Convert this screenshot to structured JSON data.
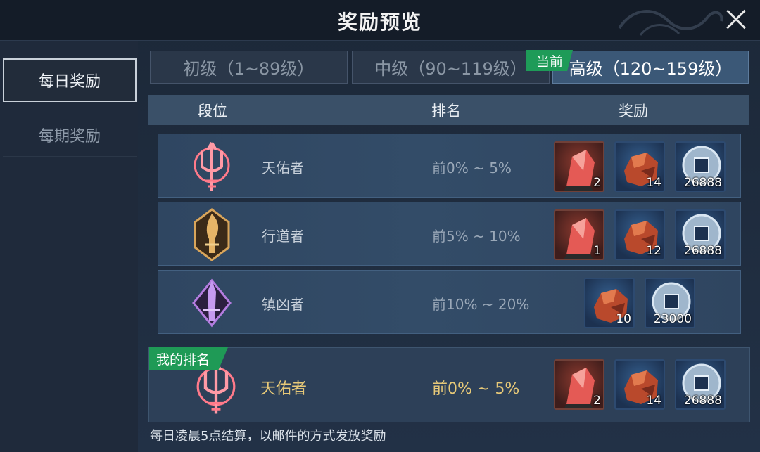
{
  "header": {
    "title": "奖励预览"
  },
  "sidebar": {
    "items": [
      {
        "label": "每日奖励"
      },
      {
        "label": "每期奖励"
      }
    ]
  },
  "tabs": [
    {
      "label": "初级（1~89级）"
    },
    {
      "label": "中级（90~119级）"
    },
    {
      "label": "高级（120~159级）"
    }
  ],
  "current_tag": "当前",
  "table": {
    "headers": [
      "段位",
      "排名",
      "奖励"
    ]
  },
  "rows": [
    {
      "rank": "天佑者",
      "range": "前0% ~ 5%",
      "rewards": [
        {
          "icon": "red-crystal-icon",
          "count": "2"
        },
        {
          "icon": "ore-chunk-icon",
          "count": "14"
        },
        {
          "icon": "coin-icon",
          "count": "26888"
        }
      ]
    },
    {
      "rank": "行道者",
      "range": "前5% ~ 10%",
      "rewards": [
        {
          "icon": "red-crystal-icon",
          "count": "1"
        },
        {
          "icon": "ore-chunk-icon",
          "count": "12"
        },
        {
          "icon": "coin-icon",
          "count": "26888"
        }
      ]
    },
    {
      "rank": "镇凶者",
      "range": "前10% ~ 20%",
      "rewards": [
        {
          "icon": "ore-chunk-icon",
          "count": "10"
        },
        {
          "icon": "coin-icon",
          "count": "23000"
        }
      ]
    }
  ],
  "my_rank": {
    "tag": "我的排名",
    "rank": "天佑者",
    "range": "前0% ~ 5%",
    "rewards": [
      {
        "icon": "red-crystal-icon",
        "count": "2"
      },
      {
        "icon": "ore-chunk-icon",
        "count": "14"
      },
      {
        "icon": "coin-icon",
        "count": "26888"
      }
    ]
  },
  "footnote": "每日凌晨5点结算，以邮件的方式发放奖励",
  "colors": {
    "accent_green": "#1e9b58",
    "gold_text": "#e7c978",
    "active_tab": "#3b5877"
  }
}
